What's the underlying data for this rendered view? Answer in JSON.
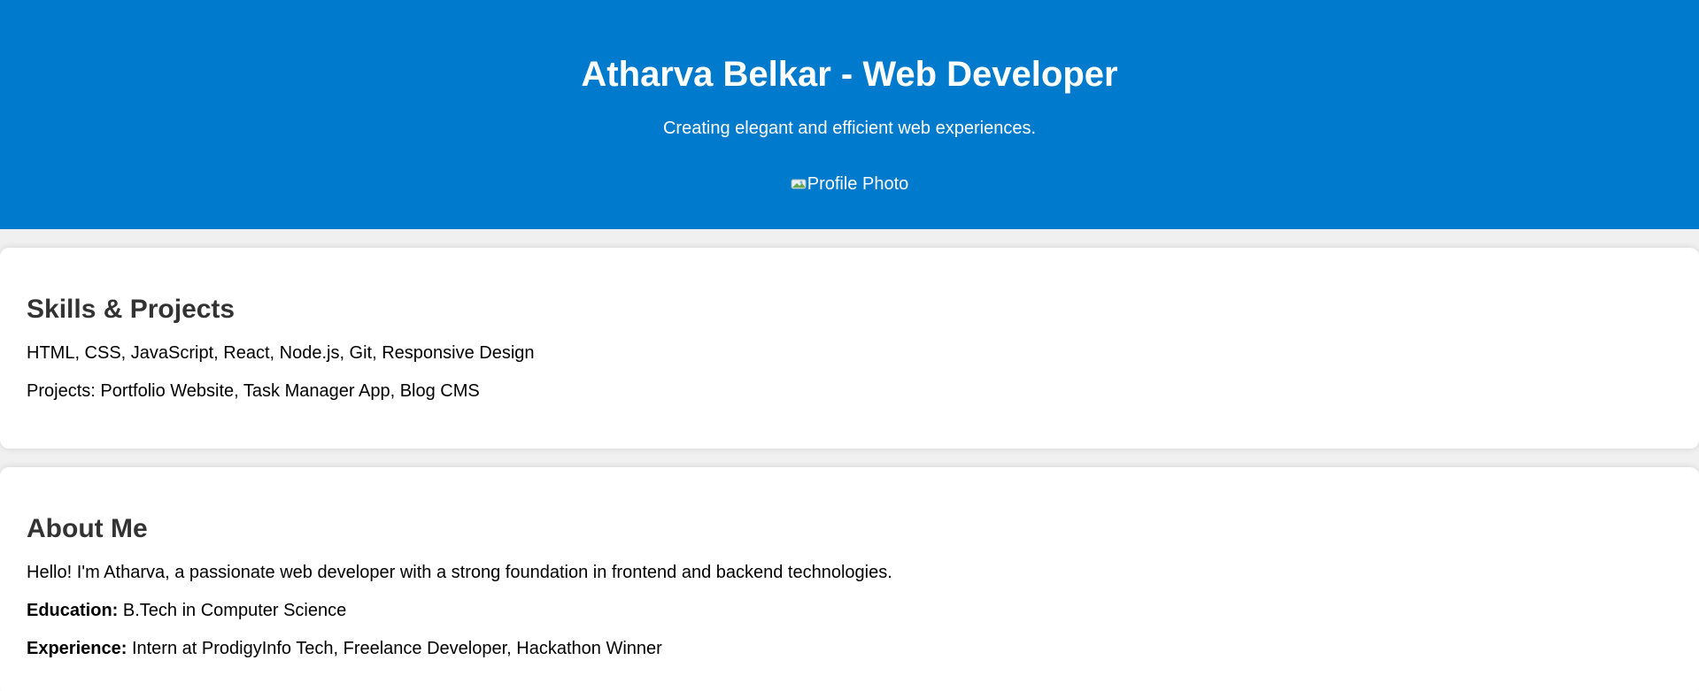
{
  "header": {
    "title": "Atharva Belkar - Web Developer",
    "tagline": "Creating elegant and efficient web experiences.",
    "profile_photo_alt": "Profile Photo",
    "background_color": "#007acc"
  },
  "skills": {
    "heading": "Skills & Projects",
    "skills_list": "HTML, CSS, JavaScript, React, Node.js, Git, Responsive Design",
    "projects": "Projects: Portfolio Website, Task Manager App, Blog CMS"
  },
  "about": {
    "heading": "About Me",
    "intro": "Hello! I'm Atharva, a passionate web developer with a strong foundation in frontend and backend technologies.",
    "education_label": "Education:",
    "education_value": " B.Tech in Computer Science",
    "experience_label": "Experience:",
    "experience_value": " Intern at ProdigyInfo Tech, Freelance Developer, Hackathon Winner"
  }
}
